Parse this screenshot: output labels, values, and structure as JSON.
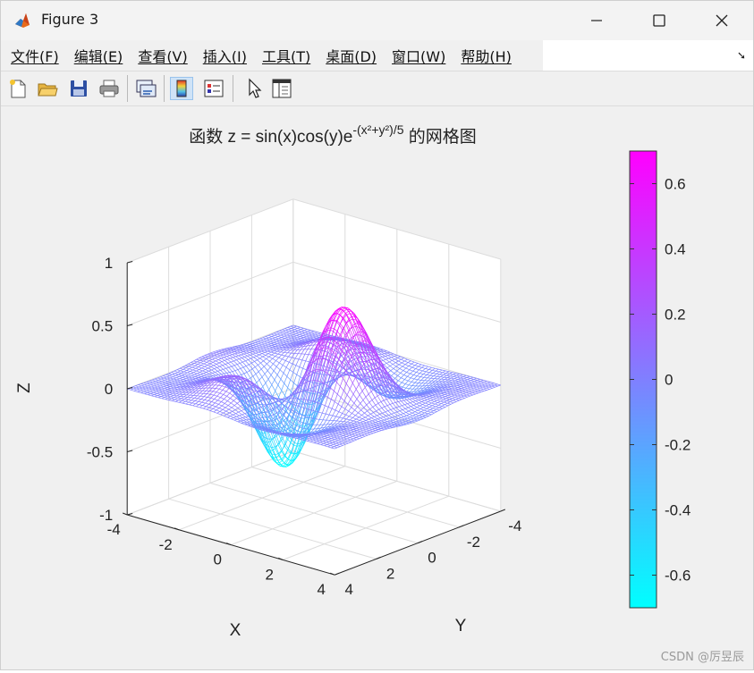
{
  "window": {
    "title": "Figure 3",
    "controls": {
      "minimize": "minimize",
      "maximize": "maximize",
      "close": "close"
    }
  },
  "menu": [
    "文件(F)",
    "编辑(E)",
    "查看(V)",
    "插入(I)",
    "工具(T)",
    "桌面(D)",
    "窗口(W)",
    "帮助(H)"
  ],
  "toolbar": {
    "buttons": [
      "new-figure-icon",
      "open-file-icon",
      "save-icon",
      "print-icon",
      "link-plot-icon",
      "colorbar-icon",
      "legend-icon",
      "pointer-icon",
      "property-inspector-icon"
    ],
    "active": "colorbar-icon"
  },
  "chart_data": {
    "type": "mesh",
    "title_prefix": "函数 z = sin(x)cos(y)e",
    "title_exponent": "-(x²+y²)/5",
    "title_suffix": " 的网格图",
    "function": "z = sin(x)cos(y)exp(-(x^2+y^2)/5)",
    "xlabel": "X",
    "ylabel": "Y",
    "zlabel": "Z",
    "xlim": [
      -4,
      4
    ],
    "ylim": [
      -4,
      4
    ],
    "zlim": [
      -1,
      1
    ],
    "x_ticks": [
      "-4",
      "-2",
      "0",
      "2",
      "4"
    ],
    "y_ticks": [
      "-4",
      "-2",
      "0",
      "2",
      "4"
    ],
    "z_ticks": [
      "1",
      "0.5",
      "0",
      "-0.5",
      "-1"
    ],
    "grid": true,
    "colormap": "cool",
    "colormap_colors": [
      "#00ffff",
      "#ff00ff"
    ],
    "colorbar": {
      "range": [
        -0.7,
        0.7
      ],
      "ticks": [
        "0.6",
        "0.4",
        "0.2",
        "0",
        "-0.2",
        "-0.4",
        "-0.6"
      ]
    }
  },
  "watermark": "CSDN @厉昱辰"
}
